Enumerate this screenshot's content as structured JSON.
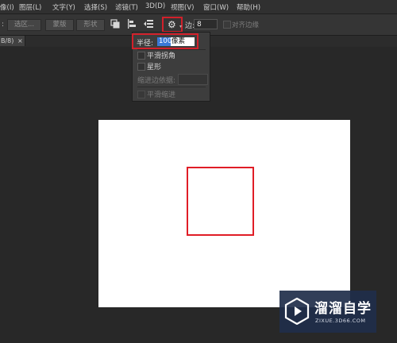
{
  "menubar": {
    "items": [
      {
        "text": "像(I)",
        "acc": "I"
      },
      {
        "text": "图层(L)",
        "acc": "L"
      },
      {
        "text": "文字(Y)",
        "acc": "Y"
      },
      {
        "text": "选择(S)",
        "acc": "S"
      },
      {
        "text": "滤镜(T)",
        "acc": "T"
      },
      {
        "text": "3D(D)",
        "acc": "D"
      },
      {
        "text": "视图(V)",
        "acc": "V"
      },
      {
        "text": "窗口(W)",
        "acc": "W"
      },
      {
        "text": "帮助(H)",
        "acc": "H"
      }
    ]
  },
  "options": {
    "colon": ":",
    "select_subject": "选区...",
    "mask": "蒙版",
    "shape": "形状",
    "edge_label": "边:",
    "edge_value": "8",
    "align_edges": "对齐边缘"
  },
  "document_tab": {
    "label": "B/8)",
    "close": "×"
  },
  "dropdown": {
    "radius_label": "半径:",
    "radius_value": "100",
    "radius_unit": "像素",
    "smooth_corners": "平滑拐角",
    "star": "星形",
    "indent_sides_by": "缩进边依据:",
    "smooth_indents": "平滑缩进"
  },
  "watermark": {
    "title": "溜溜自学",
    "url": "ZIXUE.3D66.COM"
  },
  "colors": {
    "highlight_red": "#d2202a",
    "selection_blue": "#3b79d6",
    "canvas": "#ffffff"
  }
}
